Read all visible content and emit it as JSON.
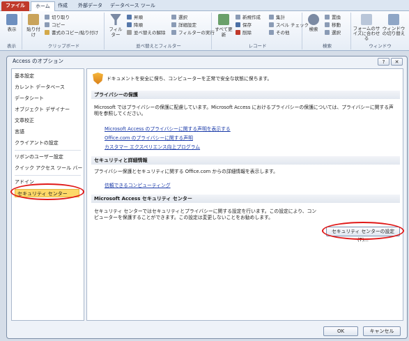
{
  "ribbon": {
    "tabs": [
      {
        "label": "ファイル"
      },
      {
        "label": "ホーム"
      },
      {
        "label": "作成"
      },
      {
        "label": "外部データ"
      },
      {
        "label": "データベース ツール"
      }
    ],
    "groups": {
      "view": {
        "label": "表示",
        "btn": "表示"
      },
      "clipboard": {
        "label": "クリップボード",
        "paste": "貼り付け",
        "cut": "切り取り",
        "copy": "コピー",
        "format_painter": "書式のコピー/貼り付け"
      },
      "sort_filter": {
        "label": "並べ替えとフィルター",
        "filter": "フィルター",
        "asc": "昇順",
        "desc": "降順",
        "clear_sort": "並べ替えの解除",
        "selection": "選択",
        "advanced": "詳細設定",
        "toggle": "フィルターの実行"
      },
      "records": {
        "label": "レコード",
        "refresh": "すべて更新",
        "new": "新規作成",
        "save": "保存",
        "delete": "削除",
        "totals": "集計",
        "spelling": "スペル チェック",
        "more": "その他"
      },
      "find": {
        "label": "検索",
        "find": "検索",
        "replace": "置換",
        "goto": "移動",
        "select": "選択"
      },
      "window": {
        "label": "ウィンドウ",
        "fit": "フォームのサイズに合わせる",
        "switch": "ウィンドウの切り替え"
      }
    }
  },
  "dialog": {
    "title": "Access のオプション",
    "help_label": "?",
    "close_label": "✕",
    "nav": [
      {
        "label": "基本設定"
      },
      {
        "label": "カレント データベース"
      },
      {
        "label": "データシート"
      },
      {
        "label": "オブジェクト デザイナー"
      },
      {
        "label": "文章校正"
      },
      {
        "label": "言語"
      },
      {
        "label": "クライアントの設定"
      },
      {
        "label": "リボンのユーザー設定"
      },
      {
        "label": "クイック アクセス ツール バー"
      },
      {
        "label": "アドイン"
      },
      {
        "label": "セキュリティ センター"
      }
    ],
    "intro": "ドキュメントを安全に保ち、コンピューターを正常で安全な状態に保ちます。",
    "privacy": {
      "header": "プライバシーの保護",
      "text": "Microsoft ではプライバシーの保護に配慮しています。Microsoft Access におけるプライバシーの保護については、プライバシーに関する声明を参照してください。",
      "links": [
        "Microsoft Access のプライバシーに関する声明を表示する",
        "Office.com のプライバシーに関する声明",
        "カスタマー エクスペリエンス向上プログラム"
      ]
    },
    "security_info": {
      "header": "セキュリティと詳細情報",
      "text": "プライバシー保護とセキュリティに関する Office.com からの詳細情報を表示します。",
      "link": "信頼できるコンピューティング"
    },
    "trust_center": {
      "header": "Microsoft Access セキュリティ センター",
      "text": "セキュリティ センターではセキュリティとプライバシーに関する設定を行います。この設定により、コンピューターを保護することができます。この設定は変更しないことをお勧めします。",
      "button": "セキュリティ センターの設定(T)..."
    },
    "ok": "OK",
    "cancel": "キャンセル"
  },
  "colors": {
    "file_tab": "#c0392b",
    "selected_nav": "#fdd868",
    "annotation_ring": "#e01818"
  }
}
